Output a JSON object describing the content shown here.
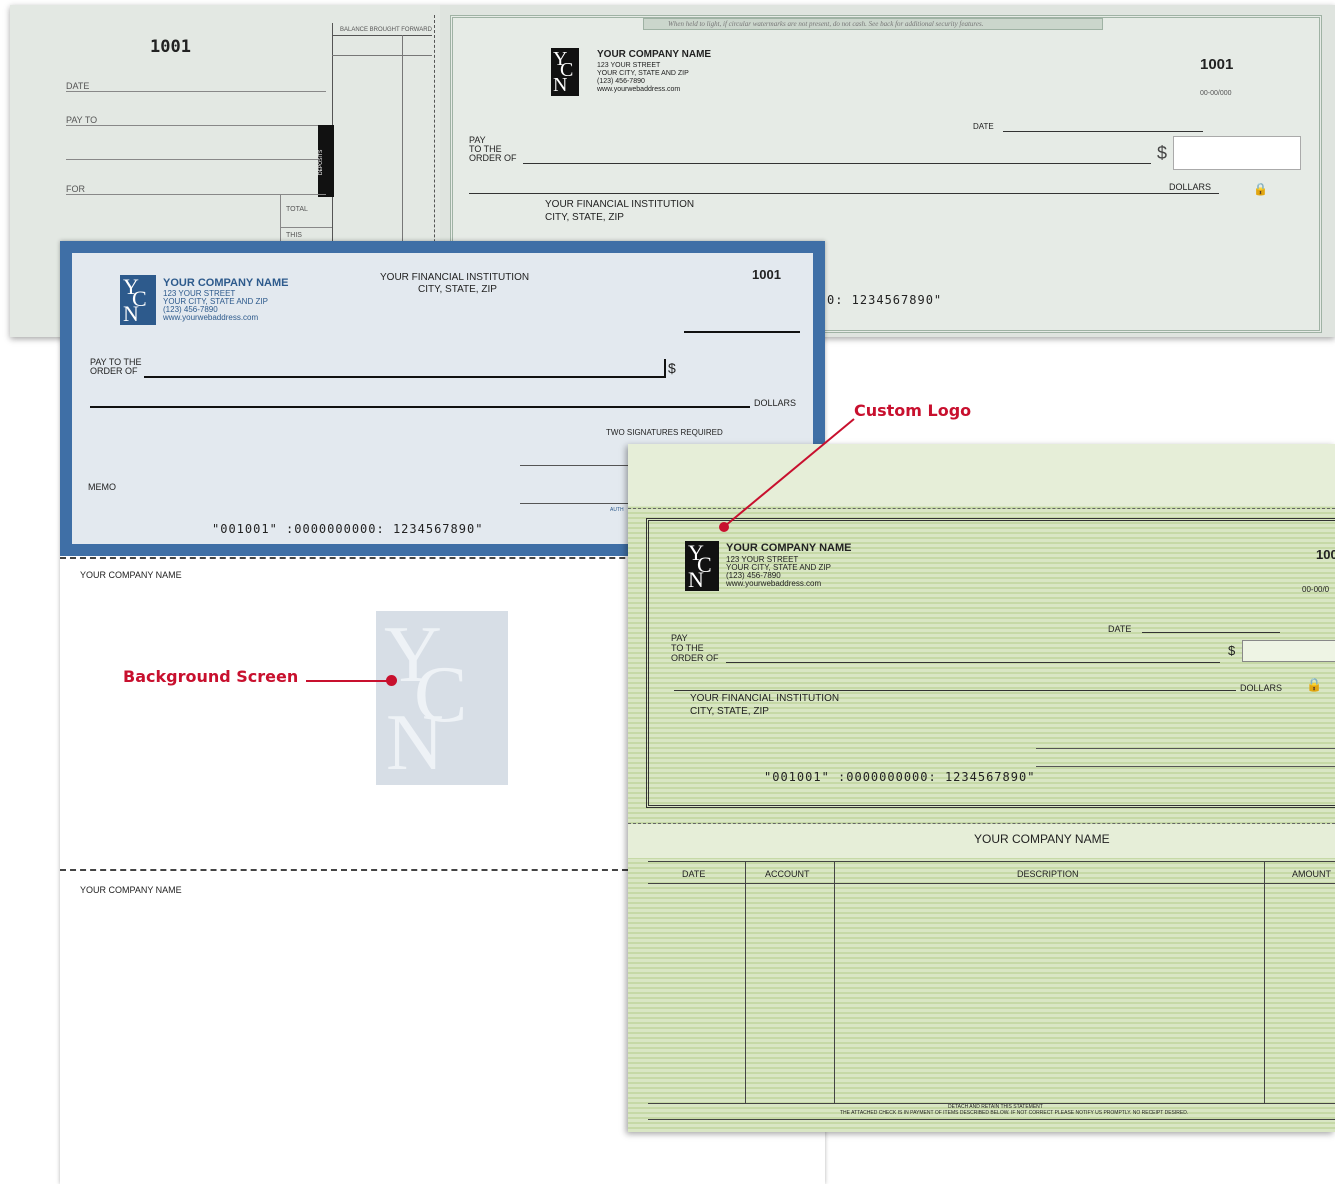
{
  "check1": {
    "stub_number": "1001",
    "balance_label": "BALANCE BROUGHT FORWARD",
    "date_label": "DATE",
    "payto_label": "PAY TO",
    "for_label": "FOR",
    "total_label": "TOTAL",
    "this_label": "THIS",
    "deposits_label": "DEPOSITS",
    "security_banner": "When held to light, if circular watermarks are not present, do not cash. See back for additional security features.",
    "company_name": "YOUR COMPANY NAME",
    "street": "123 YOUR STREET",
    "city": "YOUR CITY, STATE AND ZIP",
    "phone": "(123) 456-7890",
    "web": "www.yourwebaddress.com",
    "check_number": "1001",
    "routing_fraction": "00-00/000",
    "date_label2": "DATE",
    "pay_label": "PAY",
    "to_the_label": "TO THE",
    "order_of_label": "ORDER OF",
    "dollar_sign": "$",
    "dollars_label": "DOLLARS",
    "bank_name": "YOUR FINANCIAL INSTITUTION",
    "bank_city": "CITY, STATE, ZIP",
    "micr": "0: 1234567890\""
  },
  "check2": {
    "company_name": "YOUR COMPANY NAME",
    "street": "123 YOUR STREET",
    "city": "YOUR CITY, STATE AND ZIP",
    "phone": "(123) 456-7890",
    "web": "www.yourwebaddress.com",
    "bank_name": "YOUR FINANCIAL INSTITUTION",
    "bank_city": "CITY, STATE, ZIP",
    "check_number": "1001",
    "pay_to_label": "PAY TO THE",
    "order_of_label": "ORDER OF",
    "dollar_sign": "$",
    "dollars_label": "DOLLARS",
    "two_sig": "TWO SIGNATURES REQUIRED",
    "memo_label": "MEMO",
    "auth_label": "AUTH",
    "micr": "\"001001\"   :0000000000: 1234567890\"",
    "stub1_company": "YOUR COMPANY NAME",
    "stub2_company": "YOUR COMPANY NAME",
    "bg_logo": {
      "l1": "Y",
      "l2": "C",
      "l3": "N"
    }
  },
  "check3": {
    "company_name": "YOUR COMPANY NAME",
    "street": "123 YOUR STREET",
    "city": "YOUR CITY, STATE AND ZIP",
    "phone": "(123) 456-7890",
    "web": "www.yourwebaddress.com",
    "check_number": "100",
    "routing_fraction": "00-00/0",
    "date_label": "DATE",
    "pay_label": "PAY",
    "to_the_label": "TO THE",
    "order_of_label": "ORDER OF",
    "dollar_sign": "$",
    "dollars_label": "DOLLARS",
    "bank_name": "YOUR FINANCIAL INSTITUTION",
    "bank_city": "CITY, STATE, ZIP",
    "micr": "\"001001\"   :0000000000: 1234567890\"",
    "stmt_company": "YOUR COMPANY NAME",
    "columns": [
      "DATE",
      "ACCOUNT",
      "DESCRIPTION",
      "AMOUNT"
    ],
    "footer1": "DETACH AND RETAIN THIS STATEMENT",
    "footer2": "THE ATTACHED CHECK IS IN PAYMENT OF ITEMS DESCRIBED BELOW. IF NOT CORRECT PLEASE NOTIFY US PROMPTLY. NO RECEIPT DESIRED."
  },
  "logo": {
    "l1": "Y",
    "l2": "C",
    "l3": "N"
  },
  "callouts": {
    "custom_logo": "Custom Logo",
    "background_screen": "Background Screen",
    "accent_color": "#c8102e"
  }
}
